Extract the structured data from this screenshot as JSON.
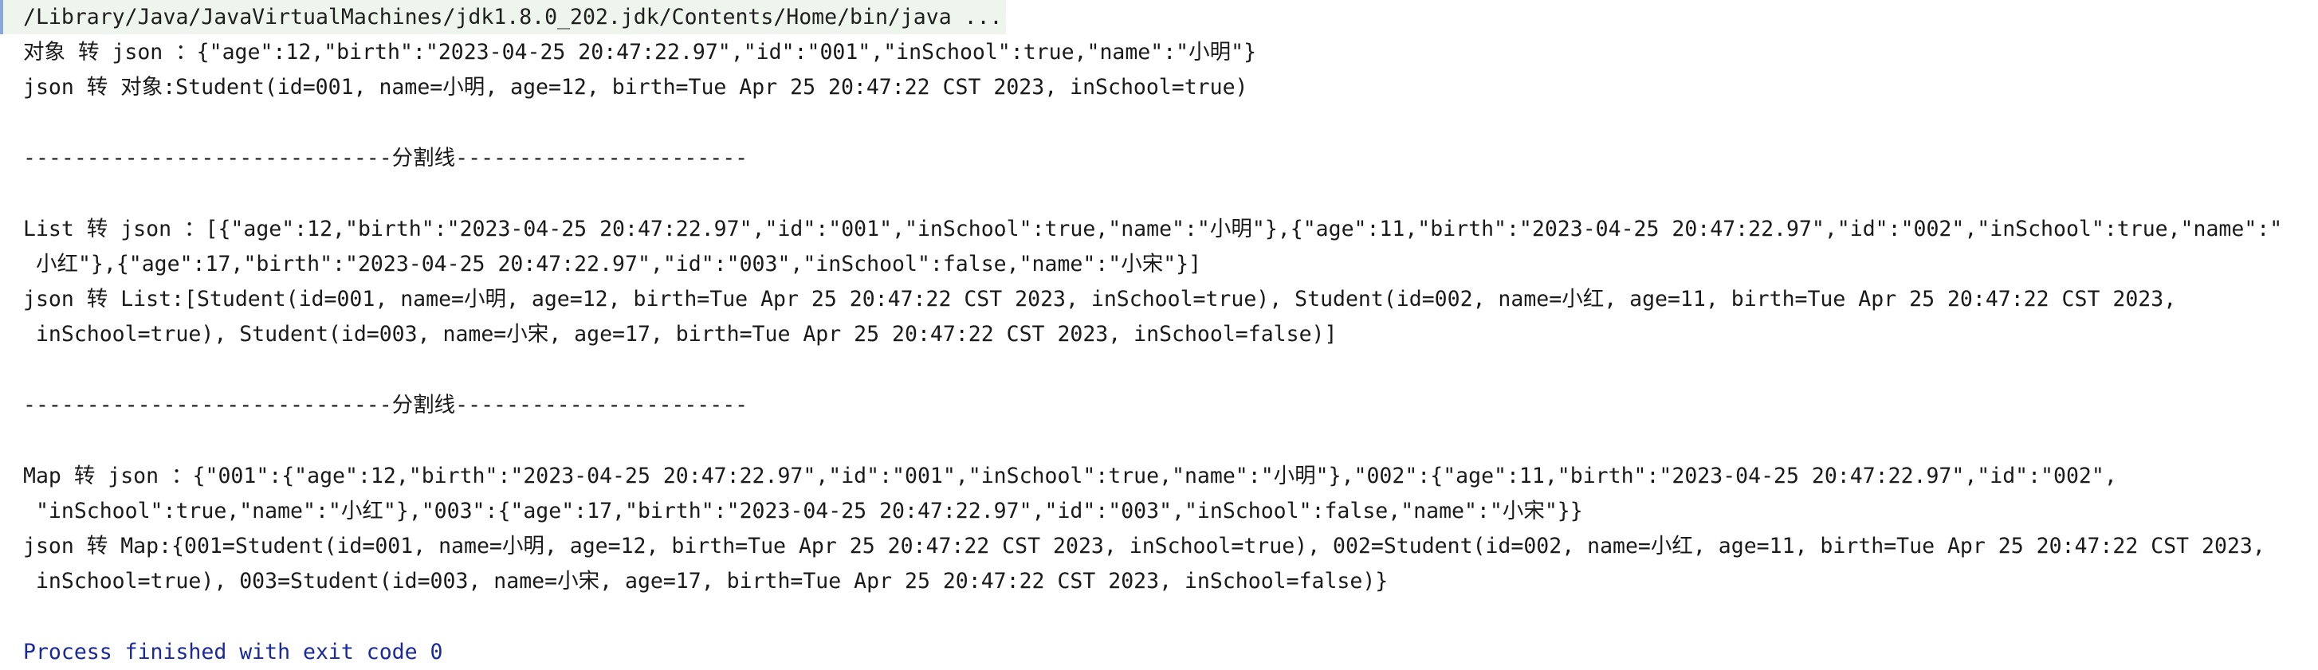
{
  "console": {
    "command": "/Library/Java/JavaVirtualMachines/jdk1.8.0_202.jdk/Contents/Home/bin/java ...",
    "lines": [
      "对象 转 json ：{\"age\":12,\"birth\":\"2023-04-25 20:47:22.97\",\"id\":\"001\",\"inSchool\":true,\"name\":\"小明\"}",
      "json 转 对象:Student(id=001, name=小明, age=12, birth=Tue Apr 25 20:47:22 CST 2023, inSchool=true)",
      "-----------------------------分割线-----------------------",
      "List 转 json ：[{\"age\":12,\"birth\":\"2023-04-25 20:47:22.97\",\"id\":\"001\",\"inSchool\":true,\"name\":\"小明\"},{\"age\":11,\"birth\":\"2023-04-25 20:47:22.97\",\"id\":\"002\",\"inSchool\":true,\"name\":\"",
      " 小红\"},{\"age\":17,\"birth\":\"2023-04-25 20:47:22.97\",\"id\":\"003\",\"inSchool\":false,\"name\":\"小宋\"}]",
      "json 转 List:[Student(id=001, name=小明, age=12, birth=Tue Apr 25 20:47:22 CST 2023, inSchool=true), Student(id=002, name=小红, age=11, birth=Tue Apr 25 20:47:22 CST 2023,",
      " inSchool=true), Student(id=003, name=小宋, age=17, birth=Tue Apr 25 20:47:22 CST 2023, inSchool=false)]",
      "-----------------------------分割线-----------------------",
      "Map 转 json ：{\"001\":{\"age\":12,\"birth\":\"2023-04-25 20:47:22.97\",\"id\":\"001\",\"inSchool\":true,\"name\":\"小明\"},\"002\":{\"age\":11,\"birth\":\"2023-04-25 20:47:22.97\",\"id\":\"002\",",
      " \"inSchool\":true,\"name\":\"小红\"},\"003\":{\"age\":17,\"birth\":\"2023-04-25 20:47:22.97\",\"id\":\"003\",\"inSchool\":false,\"name\":\"小宋\"}}",
      "json 转 Map:{001=Student(id=001, name=小明, age=12, birth=Tue Apr 25 20:47:22 CST 2023, inSchool=true), 002=Student(id=002, name=小红, age=11, birth=Tue Apr 25 20:47:22 CST 2023,",
      " inSchool=true), 003=Student(id=003, name=小宋, age=17, birth=Tue Apr 25 20:47:22 CST 2023, inSchool=false)}"
    ],
    "exit_message": "Process finished with exit code 0"
  },
  "colors": {
    "background": "#ffffff",
    "text": "#1a1a1a",
    "command_highlight": "#eef5ec",
    "exit_text": "#1a2a9e"
  }
}
